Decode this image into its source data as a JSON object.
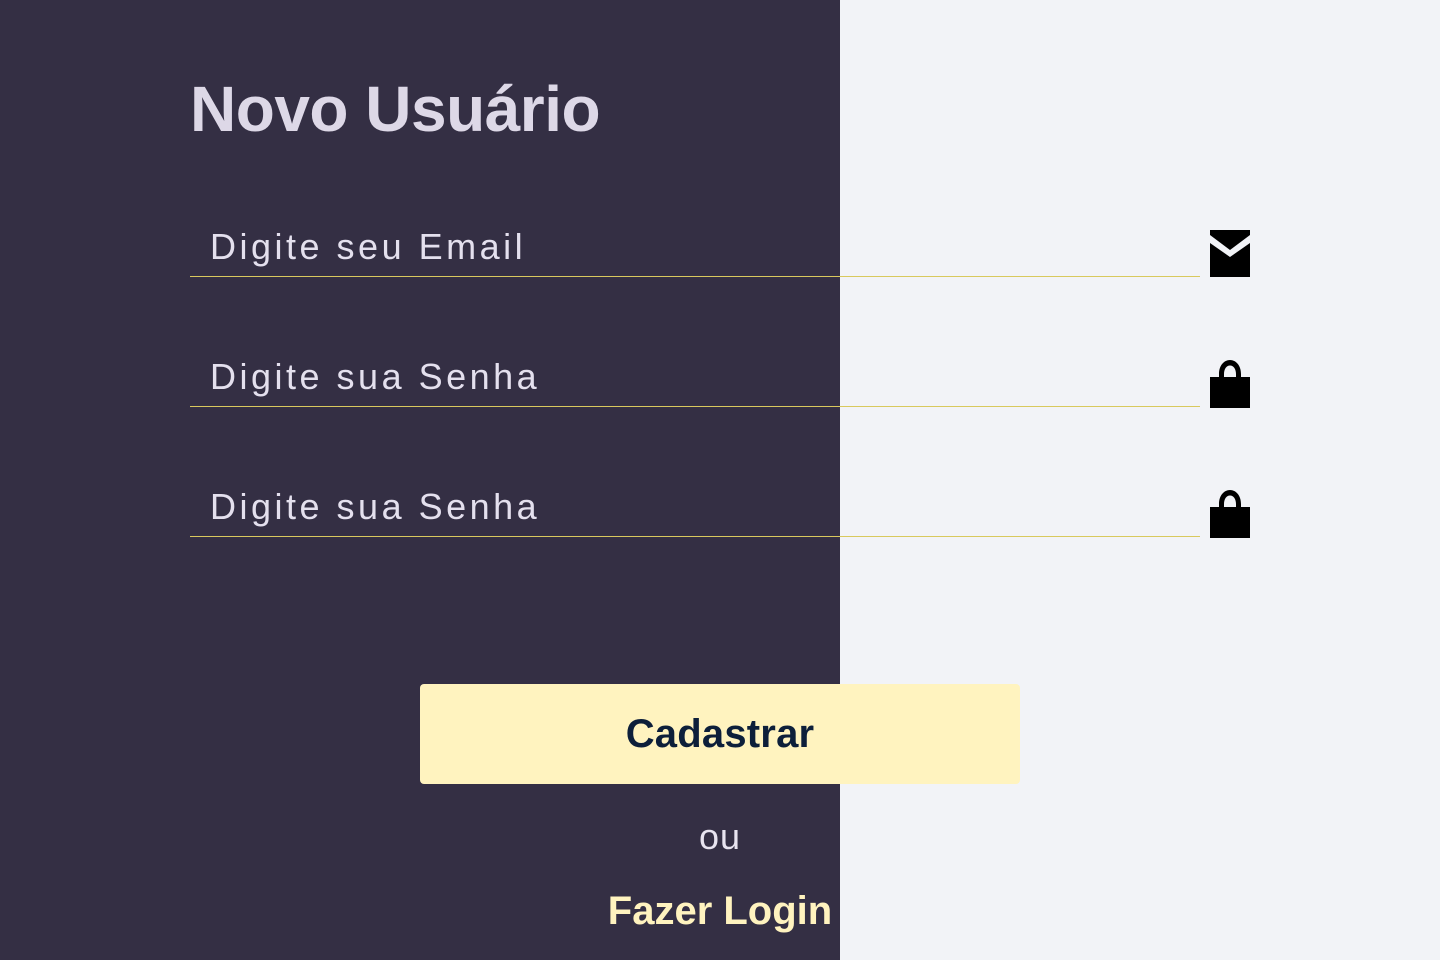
{
  "page": {
    "title": "Novo Usuário"
  },
  "form": {
    "email": {
      "value": "",
      "placeholder": "Digite seu Email",
      "icon": "envelope-icon"
    },
    "password": {
      "value": "",
      "placeholder": "Digite sua Senha",
      "icon": "lock-icon"
    },
    "confirm_password": {
      "value": "",
      "placeholder": "Digite sua Senha",
      "icon": "lock-icon"
    },
    "submit_label": "Cadastrar",
    "separator": "ou",
    "login_link": "Fazer Login"
  },
  "colors": {
    "left_panel": "#342f44",
    "right_panel": "#f2f3f7",
    "title": "#ddd8e7",
    "input_underline": "#d9c95e",
    "button_background": "#fff3bf",
    "button_text": "#0d1f3a",
    "login_link": "#fff3bf",
    "icon": "#000000"
  }
}
